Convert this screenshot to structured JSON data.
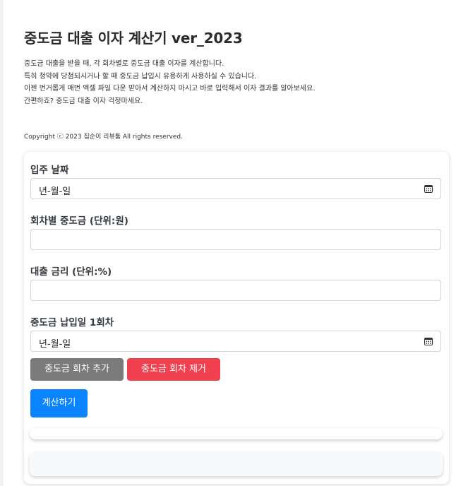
{
  "header": {
    "title": "중도금 대출 이자 계산기 ver_2023",
    "description": [
      "중도금 대출을 받을 때, 각 회차별로 중도금 대출 이자를 계산합니다.",
      "특히 청약에 당첨되시거나 할 때 중도금 납입시 유용하게 사용하실 수 있습니다.",
      "이젠 번거롭게 매번 엑셀 파일 다운 받아서 계산하지 마시고 바로 입력해서 이자 결과를 알아보세요.",
      "간편하죠? 중도금 대출 이자 걱정마세요."
    ],
    "copyright": "Copyright ⓒ 2023 집순이 리뷰툼 All rights reserved."
  },
  "form": {
    "move_in_date": {
      "label": "입주 날짜",
      "placeholder": "년-월-일"
    },
    "installment_amount": {
      "label": "회차별 중도금 (단위:원)",
      "value": ""
    },
    "interest_rate": {
      "label": "대출 금리 (단위:%)",
      "value": ""
    },
    "payment_date_1": {
      "label": "중도금 납입일 1회차",
      "placeholder": "년-월-일"
    },
    "add_button": "중도금 회차 추가",
    "remove_button": "중도금 회차 제거",
    "calculate_button": "계산하기"
  },
  "icons": {
    "date_picker": "calendar-icon"
  },
  "colors": {
    "add_button": "#7b7b7b",
    "remove_button": "#f1404f",
    "calculate_button": "#0a84ff"
  }
}
